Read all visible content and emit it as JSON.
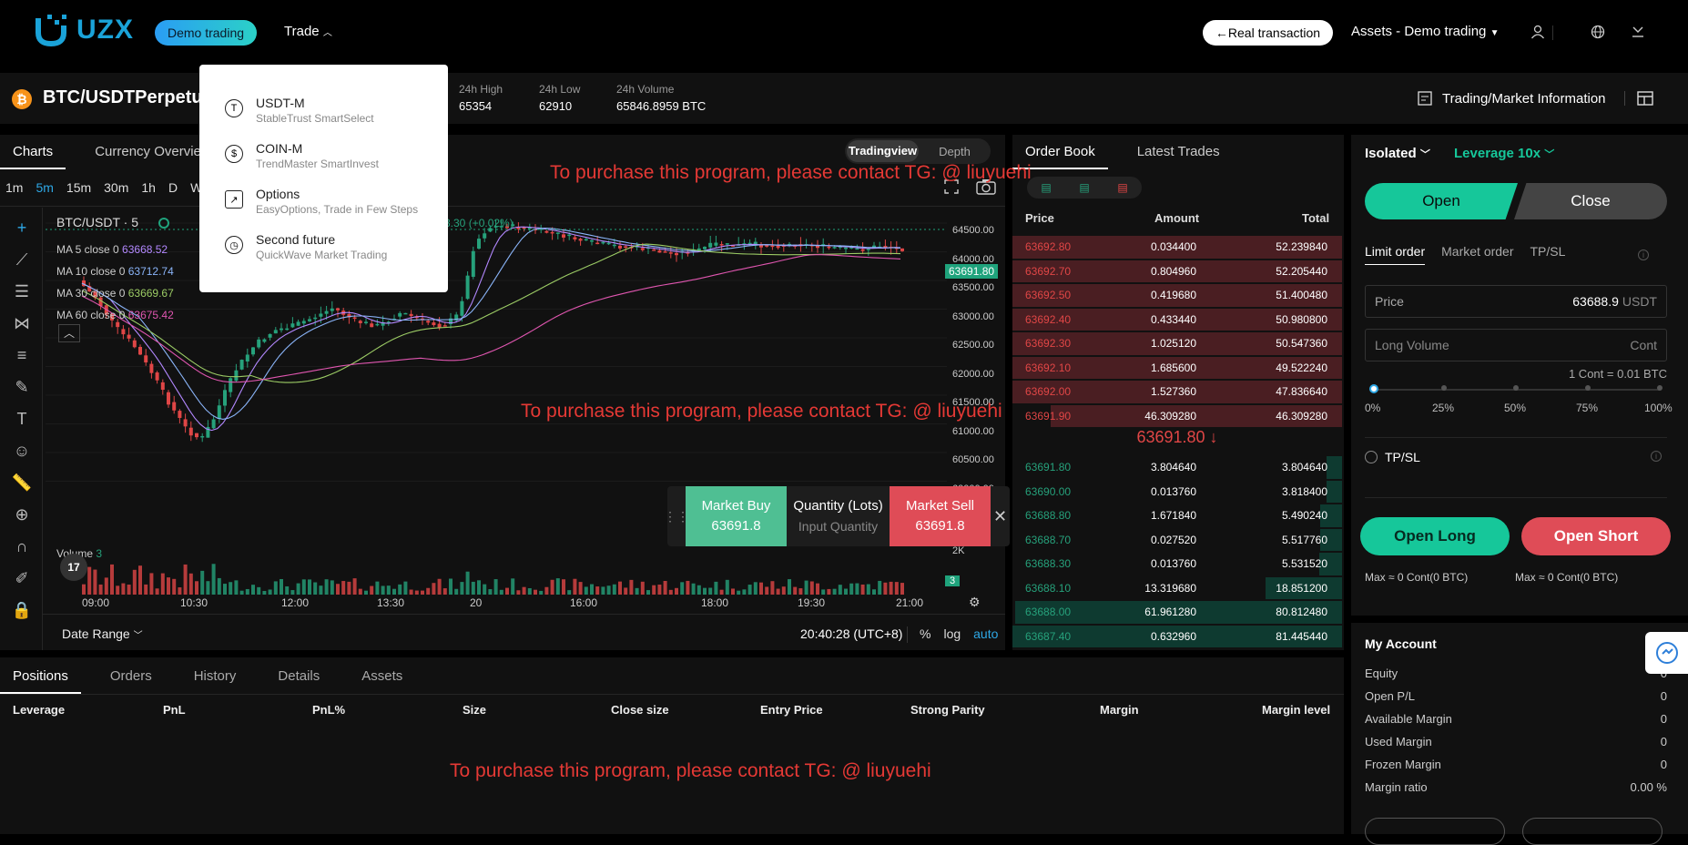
{
  "header": {
    "brand": "UZX",
    "demo_label": "Demo trading",
    "trade_label": "Trade",
    "real_label": "Real transaction",
    "assets_label": "Assets - Demo trading"
  },
  "trade_dropdown": [
    {
      "title": "USDT-M",
      "subtitle": "StableTrust SmartSelect",
      "icon": "usdt-icon"
    },
    {
      "title": "COIN-M",
      "subtitle": "TrendMaster SmartInvest",
      "icon": "coin-icon"
    },
    {
      "title": "Options",
      "subtitle": "EasyOptions, Trade in Few Steps",
      "icon": "options-icon"
    },
    {
      "title": "Second future",
      "subtitle": "QuickWave Market Trading",
      "icon": "timer-icon"
    }
  ],
  "pair": {
    "name": "BTC/USDTPerpetu",
    "stats": [
      {
        "label": "24h High",
        "value": "65354"
      },
      {
        "label": "24h Low",
        "value": "62910"
      },
      {
        "label": "24h Volume",
        "value": "65846.8959 BTC"
      }
    ],
    "market_info_label": "Trading/Market Information"
  },
  "chart": {
    "tabs": [
      "Charts",
      "Currency Overview"
    ],
    "view_toggle": [
      "Tradingview",
      "Depth"
    ],
    "intervals": [
      "1m",
      "5m",
      "15m",
      "30m",
      "1h",
      "D",
      "W"
    ],
    "selected_interval": "5m",
    "symbol": "BTC/USDT · 5",
    "change_text": "3.30 (+0.02%)",
    "ma": [
      {
        "label": "MA 5 close 0",
        "value": "63668.52",
        "color": "#b388ff"
      },
      {
        "label": "MA 10 close 0",
        "value": "63712.74",
        "color": "#8ab4f8"
      },
      {
        "label": "MA 30 close 0",
        "value": "63669.67",
        "color": "#9ccc65"
      },
      {
        "label": "MA 60 close 0",
        "value": "63675.42",
        "color": "#e056b0"
      }
    ],
    "price_ticks": [
      "64500.00",
      "64000.00",
      "63500.00",
      "63000.00",
      "62500.00",
      "62000.00",
      "61500.00",
      "61000.00",
      "60500.00",
      "60000.00"
    ],
    "current_price_tag": "63691.80",
    "volume_label": "Volume",
    "volume_value": "3",
    "volume_tick": "2K",
    "volume_tag": "3",
    "time_ticks": [
      "09:00",
      "10:30",
      "12:00",
      "13:30",
      "20",
      "16:00",
      "18:00",
      "19:30",
      "21:00"
    ],
    "date_range": "Date Range",
    "clock": "20:40:28 (UTC+8)",
    "axis_opts": [
      "%",
      "log",
      "auto"
    ]
  },
  "quick_trade": {
    "buy_label": "Market Buy",
    "buy_price": "63691.8",
    "qty_label": "Quantity (Lots)",
    "qty_placeholder": "Input Quantity",
    "sell_label": "Market Sell",
    "sell_price": "63691.8"
  },
  "watermark": "To purchase this program, please contact TG: @ liuyuehi",
  "orderbook": {
    "tabs": [
      "Order Book",
      "Latest Trades"
    ],
    "headers": [
      "Price",
      "Amount",
      "Total"
    ],
    "asks": [
      [
        "63692.80",
        "0.034400",
        "52.239840"
      ],
      [
        "63692.70",
        "0.804960",
        "52.205440"
      ],
      [
        "63692.50",
        "0.419680",
        "51.400480"
      ],
      [
        "63692.40",
        "0.433440",
        "50.980800"
      ],
      [
        "63692.30",
        "1.025120",
        "50.547360"
      ],
      [
        "63692.10",
        "1.685600",
        "49.522240"
      ],
      [
        "63692.00",
        "1.527360",
        "47.836640"
      ],
      [
        "63691.90",
        "46.309280",
        "46.309280"
      ]
    ],
    "mid_price": "63691.80 ↓",
    "bids": [
      [
        "63691.80",
        "3.804640",
        "3.804640"
      ],
      [
        "63690.00",
        "0.013760",
        "3.818400"
      ],
      [
        "63688.80",
        "1.671840",
        "5.490240"
      ],
      [
        "63688.70",
        "0.027520",
        "5.517760"
      ],
      [
        "63688.30",
        "0.013760",
        "5.531520"
      ],
      [
        "63688.10",
        "13.319680",
        "18.851200"
      ],
      [
        "63688.00",
        "61.961280",
        "80.812480"
      ],
      [
        "63687.40",
        "0.632960",
        "81.445440"
      ]
    ]
  },
  "order_form": {
    "margin_mode": "Isolated",
    "leverage": "Leverage 10x",
    "open_label": "Open",
    "close_label": "Close",
    "order_tabs": [
      "Limit order",
      "Market order",
      "TP/SL"
    ],
    "price_label": "Price",
    "price_value": "63688.9",
    "price_unit": "USDT",
    "volume_placeholder": "Long Volume",
    "volume_unit": "Cont",
    "cont_note": "1 Cont = 0.01 BTC",
    "slider_labels": [
      "0%",
      "25%",
      "50%",
      "75%",
      "100%"
    ],
    "tpsl_label": "TP/SL",
    "open_long": "Open Long",
    "open_short": "Open Short",
    "max_long": "Max ≈ 0 Cont(0 BTC)",
    "max_short": "Max ≈ 0 Cont(0 BTC)"
  },
  "account": {
    "title": "My Account",
    "rows": [
      {
        "label": "Equity",
        "value": "0"
      },
      {
        "label": "Open P/L",
        "value": "0"
      },
      {
        "label": "Available Margin",
        "value": "0"
      },
      {
        "label": "Used Margin",
        "value": "0"
      },
      {
        "label": "Frozen Margin",
        "value": "0"
      },
      {
        "label": "Margin ratio",
        "value": "0.00 %"
      }
    ]
  },
  "positions": {
    "tabs": [
      "Positions",
      "Orders",
      "History",
      "Details",
      "Assets"
    ],
    "columns": [
      "Leverage",
      "PnL",
      "PnL%",
      "Size",
      "Close size",
      "Entry Price",
      "Strong Parity",
      "Margin",
      "Margin level"
    ]
  },
  "colors": {
    "up": "#26a17b",
    "down": "#e04646",
    "accent": "#16c79a",
    "brand": "#1aa3d9"
  }
}
